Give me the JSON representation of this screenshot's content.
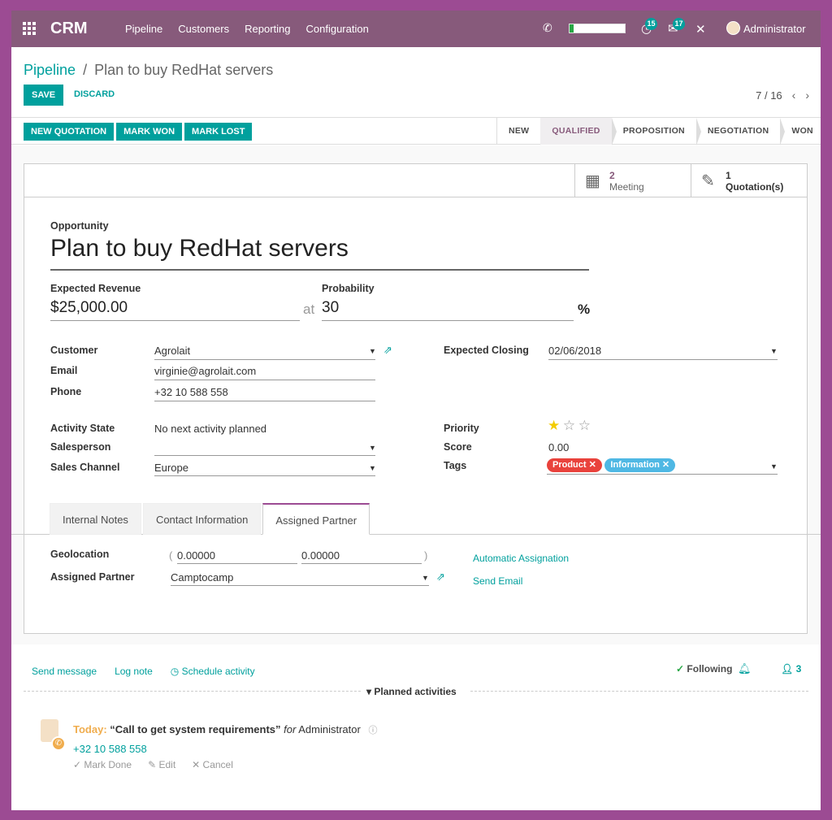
{
  "navbar": {
    "brand": "CRM",
    "menu": [
      "Pipeline",
      "Customers",
      "Reporting",
      "Configuration"
    ],
    "activity_count": "15",
    "message_count": "17",
    "user_name": "Administrator"
  },
  "breadcrumb": {
    "parent": "Pipeline",
    "separator": "/",
    "current": "Plan to buy RedHat servers"
  },
  "actions": {
    "save": "SAVE",
    "discard": "DISCARD"
  },
  "pager": {
    "value": "7 / 16",
    "prev": "‹",
    "next": "›"
  },
  "header_buttons": {
    "new_quotation": "NEW QUOTATION",
    "mark_won": "MARK WON",
    "mark_lost": "MARK LOST"
  },
  "stages": [
    "NEW",
    "QUALIFIED",
    "PROPOSITION",
    "NEGOTIATION",
    "WON"
  ],
  "active_stage": "QUALIFIED",
  "smart_buttons": {
    "meeting_count": "2",
    "meeting_label": "Meeting",
    "quotation_count": "1",
    "quotation_label": "Quotation(s)"
  },
  "form": {
    "opportunity_label": "Opportunity",
    "title": "Plan to buy RedHat servers",
    "expected_revenue_label": "Expected Revenue",
    "expected_revenue": "$25,000.00",
    "at_label": "at",
    "probability_label": "Probability",
    "probability": "30",
    "percent": "%",
    "customer_label": "Customer",
    "customer": "Agrolait",
    "email_label": "Email",
    "email": "virginie@agrolait.com",
    "phone_label": "Phone",
    "phone": "+32 10 588 558",
    "expected_closing_label": "Expected Closing",
    "expected_closing": "02/06/2018",
    "activity_state_label": "Activity State",
    "activity_state": "No next activity planned",
    "salesperson_label": "Salesperson",
    "salesperson": "",
    "sales_channel_label": "Sales Channel",
    "sales_channel": "Europe",
    "priority_label": "Priority",
    "priority_stars": 1,
    "score_label": "Score",
    "score": "0.00",
    "tags_label": "Tags",
    "tags": [
      {
        "name": "Product",
        "color": "#e9423c"
      },
      {
        "name": "Information",
        "color": "#4fb8e4"
      }
    ]
  },
  "tabs": [
    "Internal Notes",
    "Contact Information",
    "Assigned Partner"
  ],
  "active_tab": "Assigned Partner",
  "partner_tab": {
    "geolocation_label": "Geolocation",
    "paren_open": "(",
    "lat": "0.00000",
    "lng": "0.00000",
    "paren_close": ")",
    "assigned_partner_label": "Assigned Partner",
    "assigned_partner": "Camptocamp",
    "automatic_assignation": "Automatic Assignation",
    "send_email": "Send Email"
  },
  "chatter": {
    "send_message": "Send message",
    "log_note": "Log note",
    "schedule_activity": "Schedule activity",
    "following": "Following",
    "followers_count": "3",
    "planned_activities": "Planned activities",
    "activity": {
      "when": "Today",
      "title": "“Call to get system requirements”",
      "for_word": "for",
      "assignee": "Administrator",
      "phone": "+32 10 588 558",
      "mark_done": "Mark Done",
      "edit": "Edit",
      "cancel": "Cancel"
    }
  },
  "colors": {
    "brand": "#875a7b",
    "accent": "#00a09d",
    "star": "#f3cc00"
  }
}
